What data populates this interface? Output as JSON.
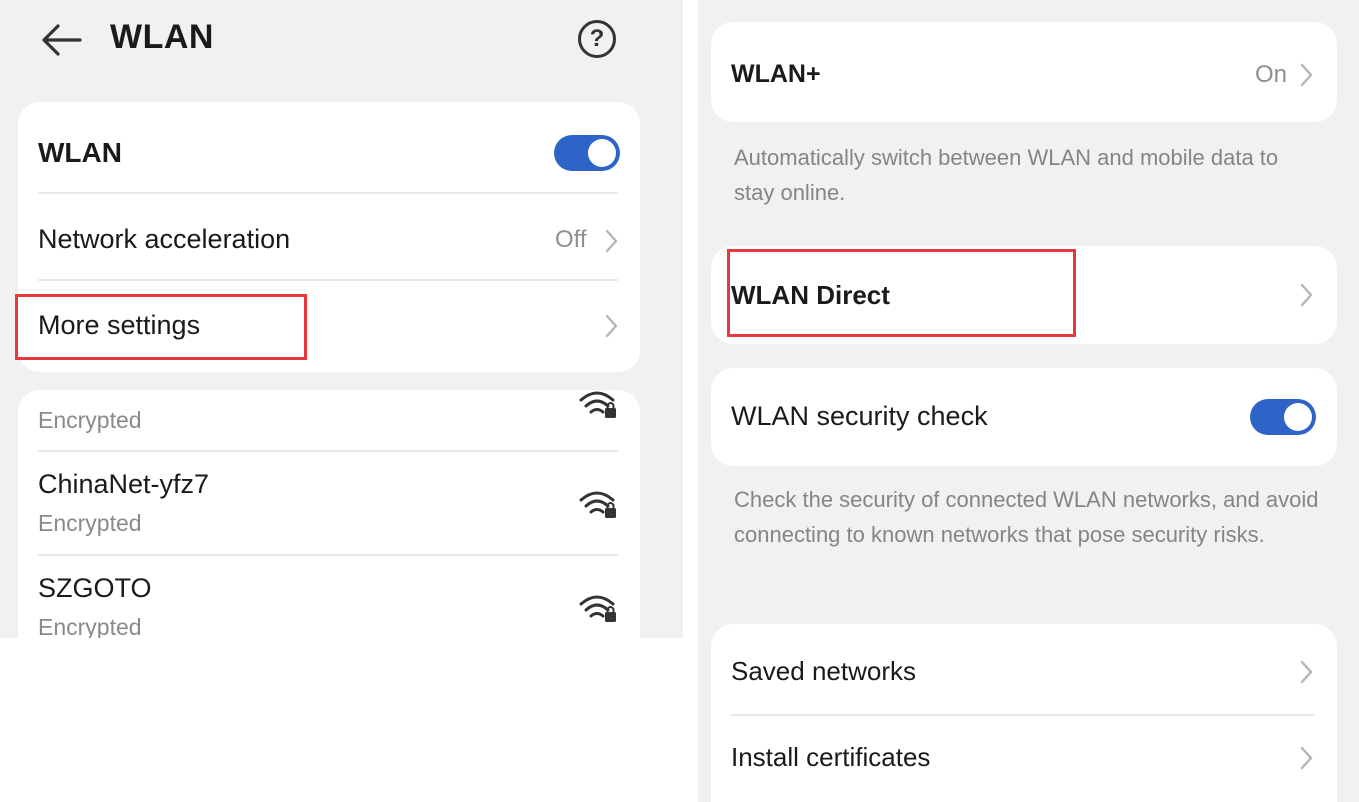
{
  "left": {
    "header": {
      "title": "WLAN",
      "back_icon": "arrow-left-icon",
      "help_icon": "question-circle-icon",
      "help_glyph": "?"
    },
    "main_card": {
      "wlan_label": "WLAN",
      "wlan_toggle_on": true,
      "network_acceleration_label": "Network acceleration",
      "network_acceleration_value": "Off",
      "more_settings_label": "More settings"
    },
    "networks": [
      {
        "name": "",
        "status": "Encrypted",
        "icon": "wifi-lock-icon"
      },
      {
        "name": "ChinaNet-yfz7",
        "status": "Encrypted",
        "icon": "wifi-lock-icon"
      },
      {
        "name": "SZGOTO",
        "status": "Encrypted",
        "icon": "wifi-lock-icon"
      }
    ]
  },
  "right": {
    "wlan_plus": {
      "label": "WLAN+",
      "value": "On",
      "description": "Automatically switch between WLAN and mobile data to stay online."
    },
    "wlan_direct": {
      "label": "WLAN Direct"
    },
    "security_check": {
      "label": "WLAN security check",
      "toggle_on": true,
      "description": "Check the security of connected WLAN networks, and avoid connecting to known networks that pose security risks."
    },
    "saved_networks": {
      "label": "Saved networks"
    },
    "install_certificates": {
      "label": "Install certificates"
    }
  },
  "colors": {
    "accent": "#2e64c7",
    "highlight": "#e5393d",
    "panel_bg": "#f1f1f1",
    "card_bg": "#ffffff",
    "secondary_text": "#8a8a8a"
  }
}
